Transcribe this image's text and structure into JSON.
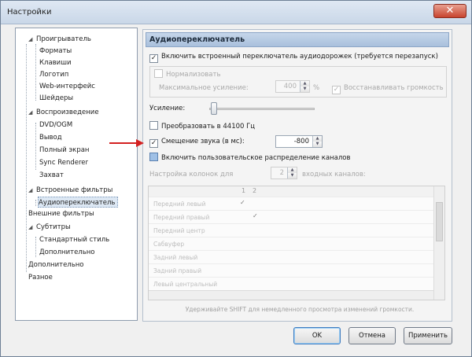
{
  "window": {
    "title": "Настройки",
    "close_glyph": "✕"
  },
  "tree": {
    "items": [
      {
        "label": "Проигрыватель",
        "expander": "◢"
      },
      {
        "label": "Форматы"
      },
      {
        "label": "Клавиши"
      },
      {
        "label": "Логотип"
      },
      {
        "label": "Web-интерфейс"
      },
      {
        "label": "Шейдеры"
      },
      {
        "label": "Воспроизведение",
        "expander": "◢"
      },
      {
        "label": "DVD/OGM"
      },
      {
        "label": "Вывод"
      },
      {
        "label": "Полный экран"
      },
      {
        "label": "Sync Renderer"
      },
      {
        "label": "Захват"
      },
      {
        "label": "Встроенные фильтры",
        "expander": "◢"
      },
      {
        "label": "Аудиопереключатель"
      },
      {
        "label": "Внешние фильтры"
      },
      {
        "label": "Субтитры",
        "expander": "◢"
      },
      {
        "label": "Стандартный стиль"
      },
      {
        "label": "Дополнительно"
      },
      {
        "label": "Дополнительно"
      },
      {
        "label": "Разное"
      }
    ]
  },
  "panel": {
    "header": "Аудиопереключатель",
    "enable_switcher": {
      "label": "Включить встроенный переключатель аудиодорожек (требуется перезапуск)",
      "checked": "✓"
    },
    "normalize": {
      "label": "Нормализовать"
    },
    "max_gain": {
      "label": "Максимальное усиление:",
      "value": "400",
      "unit": "%"
    },
    "restore_volume": {
      "label": "Восстанавливать громкость",
      "checked": "✓"
    },
    "boost_label": "Усиление:",
    "resample": {
      "label": "Преобразовать в 44100 Гц"
    },
    "time_shift": {
      "label": "Смещение звука (в мс):",
      "checked": "✓",
      "value": "-800"
    },
    "custom_mapping": {
      "label": "Включить пользовательское распределение каналов"
    },
    "channels_config": {
      "label_start": "Настройка колонок для",
      "value": "2",
      "label_end": "входных каналов:"
    },
    "grid_rows": [
      {
        "label": "Передний левый",
        "check": "✓",
        "col": 1
      },
      {
        "label": "Передний правый",
        "check": "✓",
        "col": 2
      },
      {
        "label": "Передний центр",
        "check": ""
      },
      {
        "label": "Сабвуфер",
        "check": ""
      },
      {
        "label": "Задний левый",
        "check": ""
      },
      {
        "label": "Задний правый",
        "check": ""
      },
      {
        "label": "Левый центральный",
        "check": ""
      }
    ],
    "grid_header": [
      "1",
      "2"
    ],
    "hint": "Удерживайте SHIFT для немедленного просмотра изменений громкости."
  },
  "buttons": {
    "ok": "OK",
    "cancel": "Отмена",
    "apply": "Применить"
  },
  "colors": {
    "arrow": "#d42020",
    "header_bg": "#b7cbe3"
  }
}
